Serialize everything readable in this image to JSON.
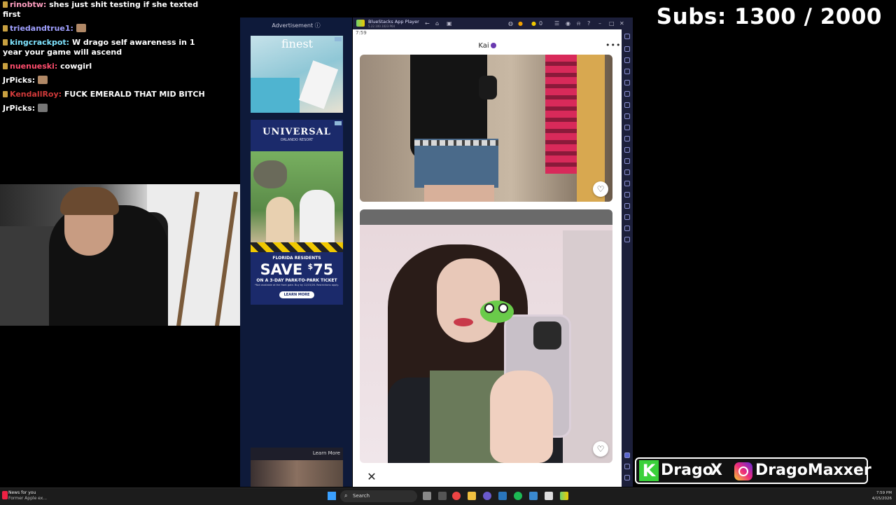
{
  "chat": {
    "messages": [
      {
        "user": "rinobtw:",
        "text": "shes just shit testing if she texted first",
        "color": "#ff9ec0"
      },
      {
        "user": "triedandtrue1:",
        "text": "",
        "color": "#a0a0ff"
      },
      {
        "user": "kingcrackpot:",
        "text": "W drago self awareness in 1 year your game will ascend",
        "color": "#7fe4ff"
      },
      {
        "user": "nuenueski:",
        "text": "cowgirl",
        "color": "#ff4d6d"
      },
      {
        "user": "JrPicks:",
        "text": "",
        "color": "#ffffff"
      },
      {
        "user": "KendallRoy:",
        "text": "FUCK EMERALD THAT MID BITCH",
        "color": "#d23a3a"
      },
      {
        "user": "JrPicks:",
        "text": "",
        "color": "#ffffff"
      }
    ]
  },
  "subs": {
    "label": "Subs: 1300 / 2000"
  },
  "ads": {
    "label": "Advertisement",
    "ad1_brand": "finest",
    "ad2_brand": "UNIVERSAL",
    "ad2_sub": "ORLANDO RESORT",
    "ad2_residents": "FLORIDA RESIDENTS",
    "ad2_save": "SAVE",
    "ad2_dollar": "$",
    "ad2_amount": "75",
    "ad2_ticket": "ON A 3-DAY PARK-TO-PARK TICKET",
    "ad2_fine": "*Not available at the front gate. Buy by 12/15/26. Restrictions apply.",
    "ad2_cta": "LEARN MORE",
    "ad3_cta": "Learn More"
  },
  "bluestacks": {
    "title": "BlueStacks App Player",
    "subtitle": "5.22.100.1023 P64",
    "time": "7:59",
    "coins": "0",
    "profile_name": "Kai",
    "more": "•••",
    "like_icon": "♡",
    "close_icon": "✕"
  },
  "social": {
    "k": "K",
    "drago": "Drago",
    "x": "X",
    "handle": "DragoMaxxer"
  },
  "taskbar": {
    "news_title": "News for you",
    "news_sub": "Former Apple ex...",
    "search": "Search",
    "time": "7:59 PM",
    "date": "4/15/2026"
  }
}
